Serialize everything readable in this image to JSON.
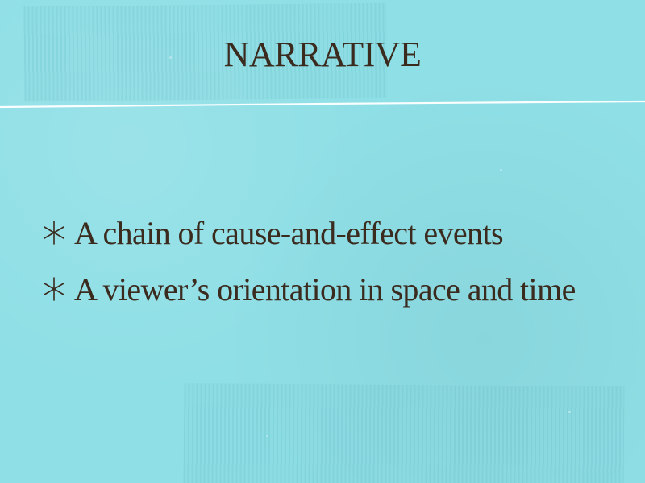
{
  "slide": {
    "title": "NARRATIVE",
    "bullet_icon": "asterisk-star-icon",
    "bullets": [
      {
        "text": "A chain of cause-and-effect events"
      },
      {
        "text": "A viewer’s orientation in space and time"
      }
    ]
  },
  "colors": {
    "background": "#8fdfe6",
    "text": "#3b2b1f",
    "divider": "#ffffff"
  }
}
